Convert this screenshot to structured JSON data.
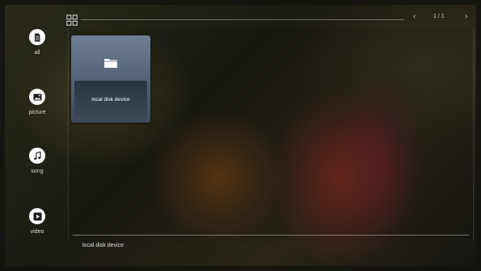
{
  "sidebar": {
    "items": [
      {
        "label": "all",
        "icon": "document-icon"
      },
      {
        "label": "picture",
        "icon": "image-icon"
      },
      {
        "label": "song",
        "icon": "music-note-icon"
      },
      {
        "label": "video",
        "icon": "play-icon"
      }
    ]
  },
  "header": {
    "view_icon": "grid-view-icon",
    "page_indicator": "1 / 1",
    "prev_icon": "chevron-left-icon",
    "next_icon": "chevron-right-icon"
  },
  "main": {
    "tiles": [
      {
        "label": "local disk device",
        "icon": "folder-icon"
      }
    ]
  },
  "footer": {
    "current_path": "local disk device"
  },
  "colors": {
    "tile": "#5f6f83",
    "icon_fill": "#ffffff",
    "icon_glyph": "#1a1a1a"
  }
}
